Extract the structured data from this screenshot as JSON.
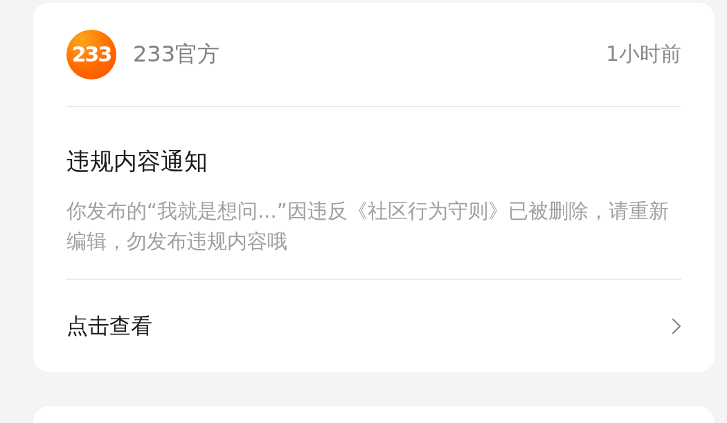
{
  "notification": {
    "sender": {
      "logo_text": "233",
      "name": "233官方"
    },
    "time": "1小时前",
    "title": "违规内容通知",
    "body": "你发布的“我就是想问...”因违反《社区行为守则》已被删除，请重新编辑，勿发布违规内容哦",
    "action": "点击查看"
  },
  "next_card": {
    "kind": "card"
  }
}
